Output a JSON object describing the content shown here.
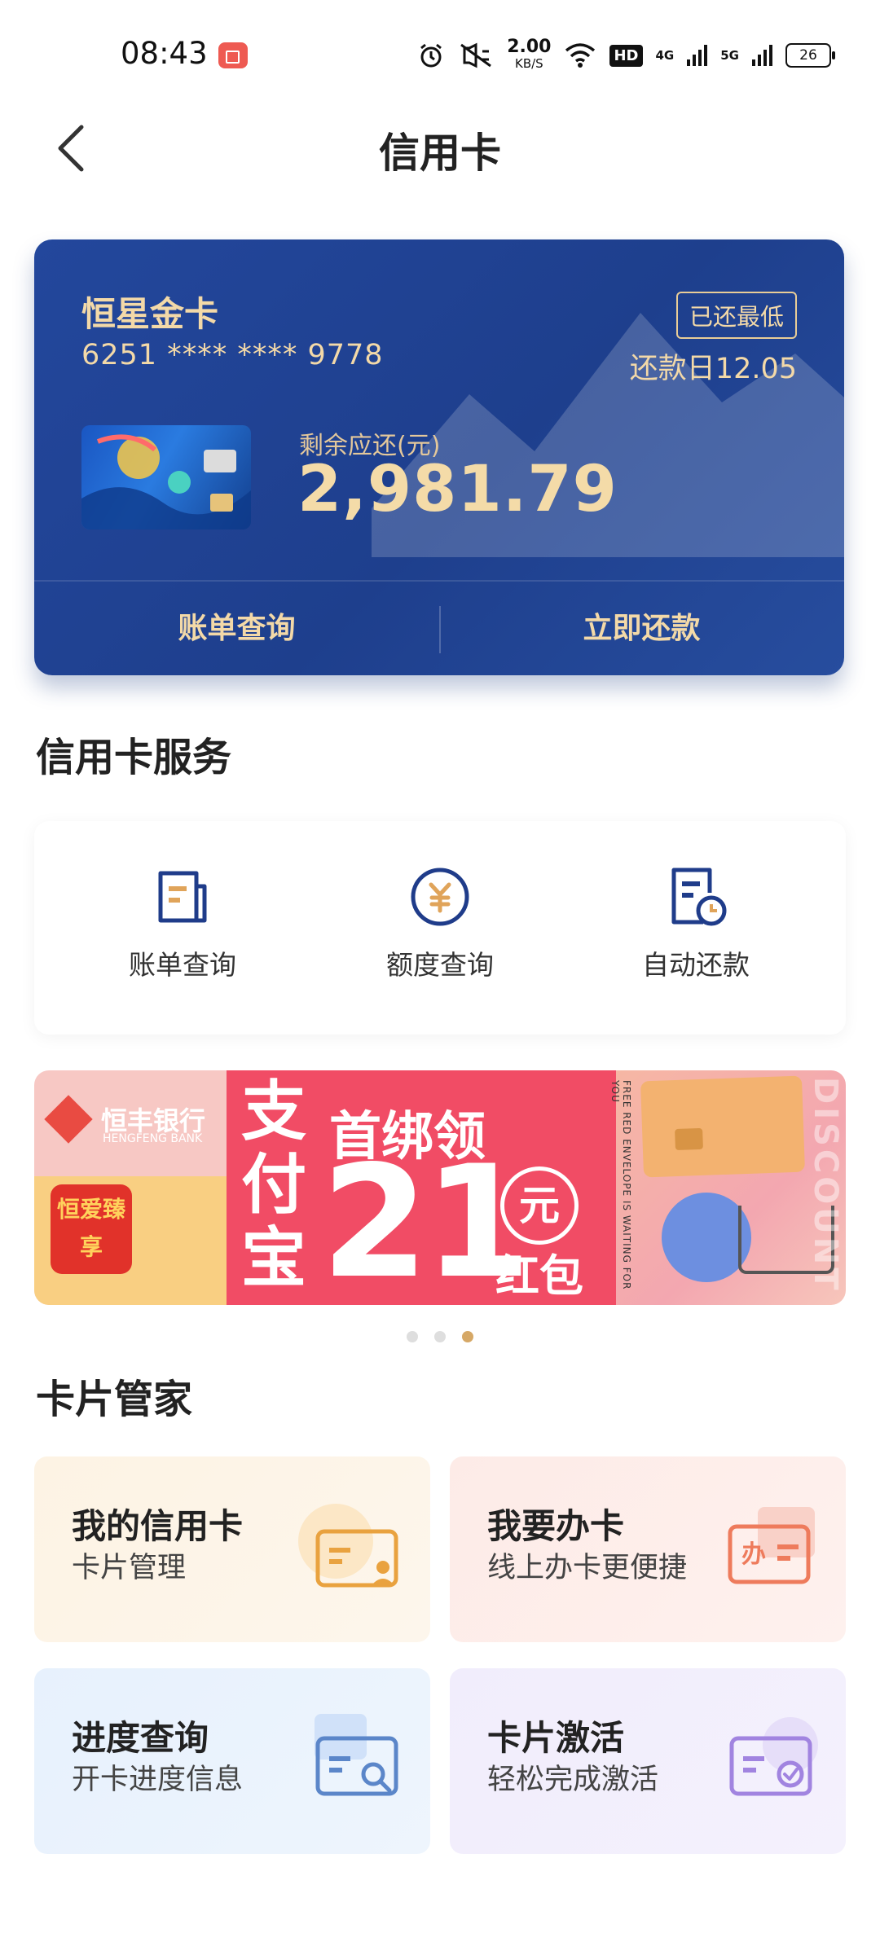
{
  "status_bar": {
    "time": "08:43",
    "speed_value": "2.00",
    "speed_unit": "KB/S",
    "hd": "HD",
    "net1": "4G",
    "net2": "5G",
    "battery": "26"
  },
  "header": {
    "title": "信用卡"
  },
  "card": {
    "name": "恒星金卡",
    "number": "6251 **** **** 9778",
    "status_badge": "已还最低",
    "due_date": "还款日12.05",
    "remaining_label": "剩余应还(元)",
    "remaining_amount": "2,981.79",
    "actions": [
      {
        "label": "账单查询"
      },
      {
        "label": "立即还款"
      }
    ],
    "colors": {
      "panel": "#23479c",
      "gold_text": "#f3d9a8"
    }
  },
  "services": {
    "title": "信用卡服务",
    "items": [
      {
        "label": "账单查询",
        "icon": "bill-icon"
      },
      {
        "label": "额度查询",
        "icon": "yuan-coin-icon"
      },
      {
        "label": "自动还款",
        "icon": "auto-pay-clock-icon"
      }
    ]
  },
  "banner": {
    "brand": "恒丰银行",
    "brand_en": "HENGFENG BANK",
    "stamp_text": "恒爱臻享",
    "left_text": "支付宝",
    "line1": "首绑领",
    "amount": "21",
    "yuan": "元",
    "red_packet": "红包",
    "vertical_text": "FREE RED ENVELOPE IS WAITING FOR YOU",
    "discount_text": "DISCOUNT",
    "dots": 3,
    "active_dot": 2
  },
  "card_manager": {
    "title": "卡片管家",
    "tiles": [
      {
        "title": "我的信用卡",
        "subtitle": "卡片管理",
        "icon": "card-user-icon"
      },
      {
        "title": "我要办卡",
        "subtitle": "线上办卡更便捷",
        "icon": "apply-card-icon"
      },
      {
        "title": "进度查询",
        "subtitle": "开卡进度信息",
        "icon": "card-search-icon"
      },
      {
        "title": "卡片激活",
        "subtitle": "轻松完成激活",
        "icon": "card-check-icon"
      }
    ]
  }
}
